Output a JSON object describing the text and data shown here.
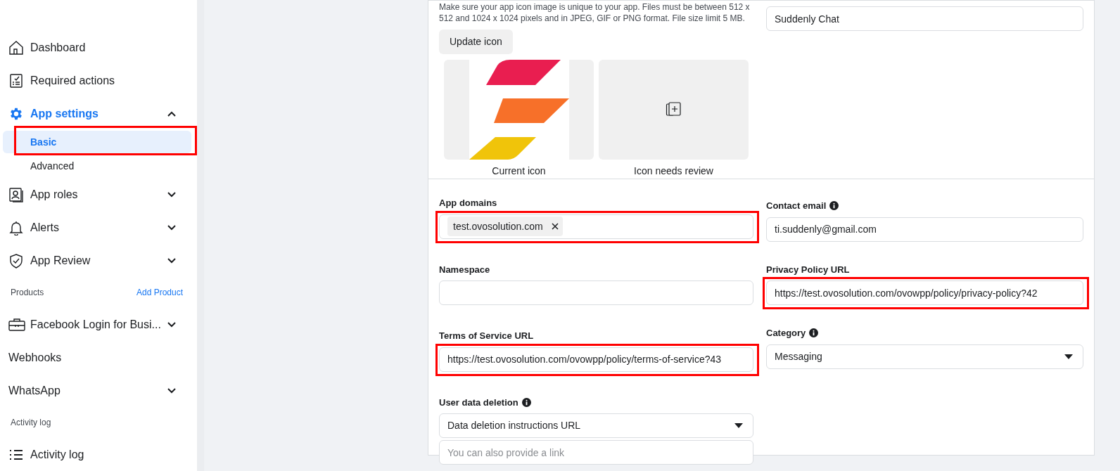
{
  "sidebar": {
    "items": [
      {
        "kind": "item",
        "label": "Dashboard"
      },
      {
        "kind": "item",
        "label": "Required actions"
      },
      {
        "kind": "item",
        "label": "App settings",
        "expanded": true,
        "active": true
      },
      {
        "kind": "sub",
        "label": "Basic",
        "selected": true,
        "highlighted": true
      },
      {
        "kind": "sub",
        "label": "Advanced",
        "selected": false,
        "highlighted": false
      },
      {
        "kind": "item",
        "label": "App roles",
        "expanded": false
      },
      {
        "kind": "item",
        "label": "Alerts",
        "expanded": false
      },
      {
        "kind": "item",
        "label": "App Review",
        "expanded": false
      },
      {
        "kind": "section",
        "label": "Products",
        "link": "Add Product"
      },
      {
        "kind": "item",
        "label": "Facebook Login for Busi...",
        "expanded": false
      },
      {
        "kind": "plain",
        "label": "Webhooks"
      },
      {
        "kind": "plain",
        "label": "WhatsApp",
        "expanded": false
      },
      {
        "kind": "section",
        "label": "Activity log"
      },
      {
        "kind": "item",
        "label": "Activity log"
      }
    ]
  },
  "icon_section": {
    "description": "Make sure your app icon image is unique to your app. Files must be between 512 x 512 and 1024 x 1024 pixels and in JPEG, GIF or PNG format. File size limit 5 MB.",
    "button": "Update icon",
    "tiles": [
      {
        "kind": "current",
        "caption": "Current icon"
      },
      {
        "kind": "pending",
        "caption": "Icon needs review"
      }
    ]
  },
  "display_name": {
    "value": "Suddenly Chat"
  },
  "form": {
    "left": [
      {
        "kind": "tags",
        "label": "App domains",
        "info": false,
        "highlighted": true,
        "tags": [
          "test.ovosolution.com"
        ]
      },
      {
        "kind": "text",
        "label": "Namespace",
        "info": false,
        "highlighted": false
      },
      {
        "kind": "text",
        "label": "Terms of Service URL",
        "info": false,
        "highlighted": true,
        "value": "https://test.ovosolution.com/ovowpp/policy/terms-of-service?43"
      },
      {
        "kind": "select",
        "label": "User data deletion",
        "info": true,
        "highlighted": false,
        "value": "Data deletion instructions URL",
        "placeholder": "You can also provide a link"
      }
    ],
    "right": [
      {
        "kind": "text",
        "label": "Contact email",
        "info": true,
        "highlighted": false,
        "value": "ti.suddenly@gmail.com"
      },
      {
        "kind": "text",
        "label": "Privacy Policy URL",
        "info": false,
        "highlighted": true,
        "value": "https://test.ovosolution.com/ovowpp/policy/privacy-policy?42"
      },
      {
        "kind": "select",
        "label": "Category",
        "info": true,
        "highlighted": false,
        "value": "Messaging"
      }
    ]
  }
}
